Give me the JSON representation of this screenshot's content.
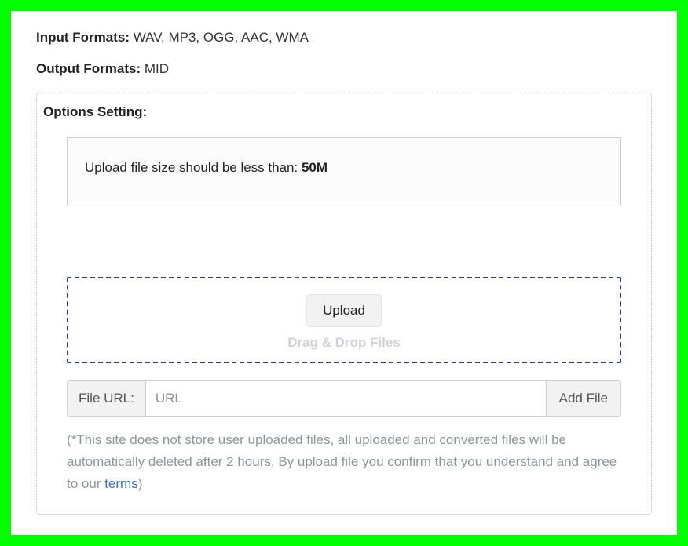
{
  "formats": {
    "input_label": "Input Formats:",
    "input_value": " WAV, MP3, OGG, AAC, WMA",
    "output_label": "Output Formats:",
    "output_value": " MID"
  },
  "options": {
    "title": "Options Setting:",
    "notice_text": "Upload file size should be less than: ",
    "notice_limit": "50M"
  },
  "upload": {
    "button_label": "Upload",
    "drag_drop_text": "Drag & Drop Files"
  },
  "file_url": {
    "label": "File URL:",
    "placeholder": "URL",
    "add_button": "Add File"
  },
  "disclaimer": {
    "text_a": "(*This site does not store user uploaded files, all uploaded and converted files will be automatically deleted after 2 hours, By upload file you confirm that you understand and agree to our ",
    "terms_link": "terms",
    "text_b": ")"
  }
}
